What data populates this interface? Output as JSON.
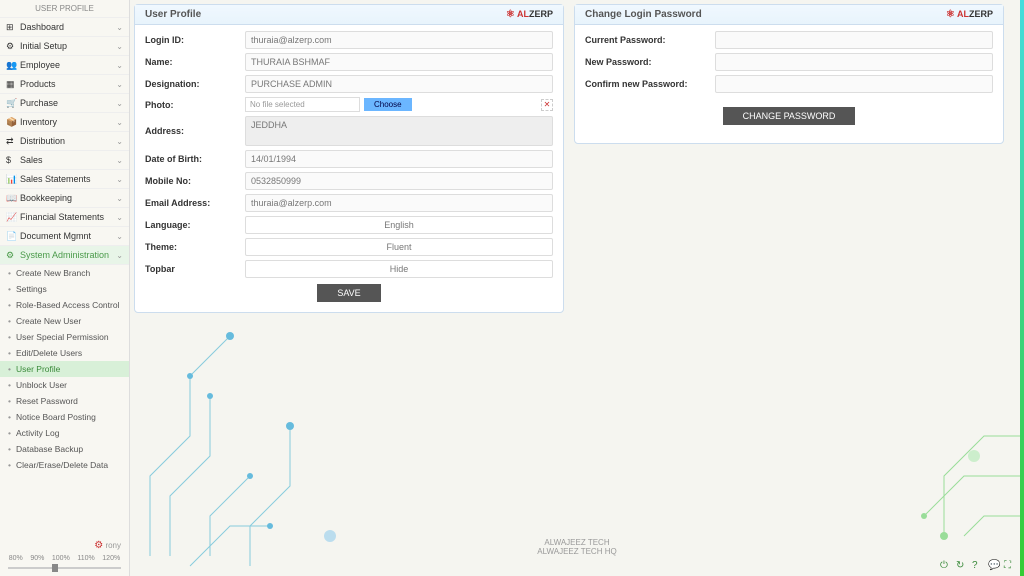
{
  "sidebar": {
    "header": "USER PROFILE",
    "items": [
      {
        "label": "Dashboard"
      },
      {
        "label": "Initial Setup"
      },
      {
        "label": "Employee"
      },
      {
        "label": "Products"
      },
      {
        "label": "Purchase"
      },
      {
        "label": "Inventory"
      },
      {
        "label": "Distribution"
      },
      {
        "label": "Sales"
      },
      {
        "label": "Sales Statements"
      },
      {
        "label": "Bookkeeping"
      },
      {
        "label": "Financial Statements"
      },
      {
        "label": "Document Mgmnt"
      },
      {
        "label": "System Administration"
      }
    ],
    "sub_items": [
      {
        "label": "Create New Branch"
      },
      {
        "label": "Settings"
      },
      {
        "label": "Role-Based Access Control"
      },
      {
        "label": "Create New User"
      },
      {
        "label": "User Special Permission"
      },
      {
        "label": "Edit/Delete Users"
      },
      {
        "label": "User Profile"
      },
      {
        "label": "Unblock User"
      },
      {
        "label": "Reset Password"
      },
      {
        "label": "Notice Board Posting"
      },
      {
        "label": "Activity Log"
      },
      {
        "label": "Database Backup"
      },
      {
        "label": "Clear/Erase/Delete Data"
      }
    ],
    "user": "rony",
    "zoom": [
      "80%",
      "90%",
      "100%",
      "110%",
      "120%"
    ]
  },
  "profile": {
    "title": "User Profile",
    "labels": {
      "login_id": "Login ID:",
      "name": "Name:",
      "designation": "Designation:",
      "photo": "Photo:",
      "address": "Address:",
      "dob": "Date of Birth:",
      "mobile": "Mobile No:",
      "email": "Email Address:",
      "language": "Language:",
      "theme": "Theme:",
      "topbar": "Topbar"
    },
    "values": {
      "login_id": "thuraia@alzerp.com",
      "name": "THURAIA BSHMAF",
      "designation": "PURCHASE ADMIN",
      "file_text": "No file selected",
      "choose": "Choose",
      "address": "JEDDHA",
      "dob": "14/01/1994",
      "mobile": "0532850999",
      "email": "thuraia@alzerp.com",
      "language": "English",
      "theme": "Fluent",
      "topbar": "Hide"
    },
    "save": "SAVE"
  },
  "password": {
    "title": "Change Login Password",
    "labels": {
      "current": "Current Password:",
      "new": "New Password:",
      "confirm": "Confirm new Password:"
    },
    "button": "CHANGE PASSWORD"
  },
  "logo": {
    "al": "AL",
    "zerp": "ZERP"
  },
  "footer": {
    "line1": "ALWAJEEZ TECH",
    "line2": "ALWAJEEZ TECH HQ"
  }
}
